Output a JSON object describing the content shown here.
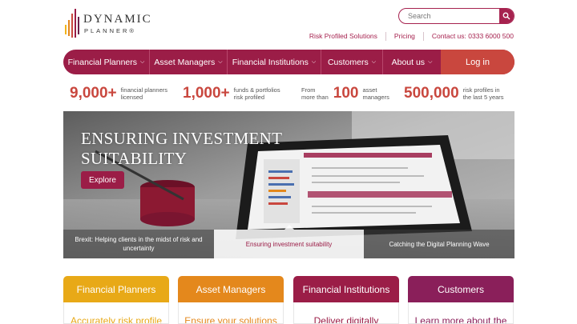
{
  "brand": {
    "line1": "DYNAMIC",
    "line2": "PLANNER®",
    "bar_colors": [
      "#f2b41c",
      "#e4881c",
      "#c9473e",
      "#9b1d47",
      "#6d1f4a"
    ]
  },
  "search": {
    "placeholder": "Search",
    "icon": "search-icon"
  },
  "top_links": [
    "Risk Profiled Solutions",
    "Pricing",
    "Contact us: 0333 6000 500"
  ],
  "nav": {
    "items": [
      {
        "label": "Financial Planners"
      },
      {
        "label": "Asset Managers"
      },
      {
        "label": "Financial Institutions"
      },
      {
        "label": "Customers"
      },
      {
        "label": "About us"
      }
    ],
    "login": "Log in",
    "color": "#9b1d47",
    "login_color": "#c9473e"
  },
  "stats": [
    {
      "number": "9,000+",
      "label_line1": "financial planners",
      "label_line2": "licensed"
    },
    {
      "number": "1,000+",
      "label_line1": "funds & portfolios",
      "label_line2": "risk profiled"
    },
    {
      "prefix_line1": "From",
      "prefix_line2": "more than",
      "number": "100",
      "label_line1": "asset",
      "label_line2": "managers"
    },
    {
      "number": "500,000",
      "label_line1": "risk profiles in",
      "label_line2": "the last 5 years"
    }
  ],
  "hero": {
    "title_line1": "ENSURING INVESTMENT",
    "title_line2": "SUITABILITY",
    "button": "Explore",
    "tabs": [
      {
        "line1": "Brexit: Helping clients in the midst of risk and",
        "line2": "uncertainty"
      },
      {
        "line1": "Ensuring investment suitability",
        "line2": ""
      },
      {
        "line1": "Catching the Digital Planning Wave",
        "line2": ""
      }
    ]
  },
  "cards": [
    {
      "title": "Financial Planners",
      "teaser": "Accurately risk profile",
      "color": "#e8a917",
      "text_color": "#e8a917"
    },
    {
      "title": "Asset Managers",
      "teaser": "Ensure your solutions",
      "color": "#e4881c",
      "text_color": "#e4881c"
    },
    {
      "title": "Financial Institutions",
      "teaser": "Deliver digitally",
      "color": "#9b1d47",
      "text_color": "#9b1d47"
    },
    {
      "title": "Customers",
      "teaser": "Learn more about the",
      "color": "#8a1f5a",
      "text_color": "#8a1f5a"
    }
  ]
}
